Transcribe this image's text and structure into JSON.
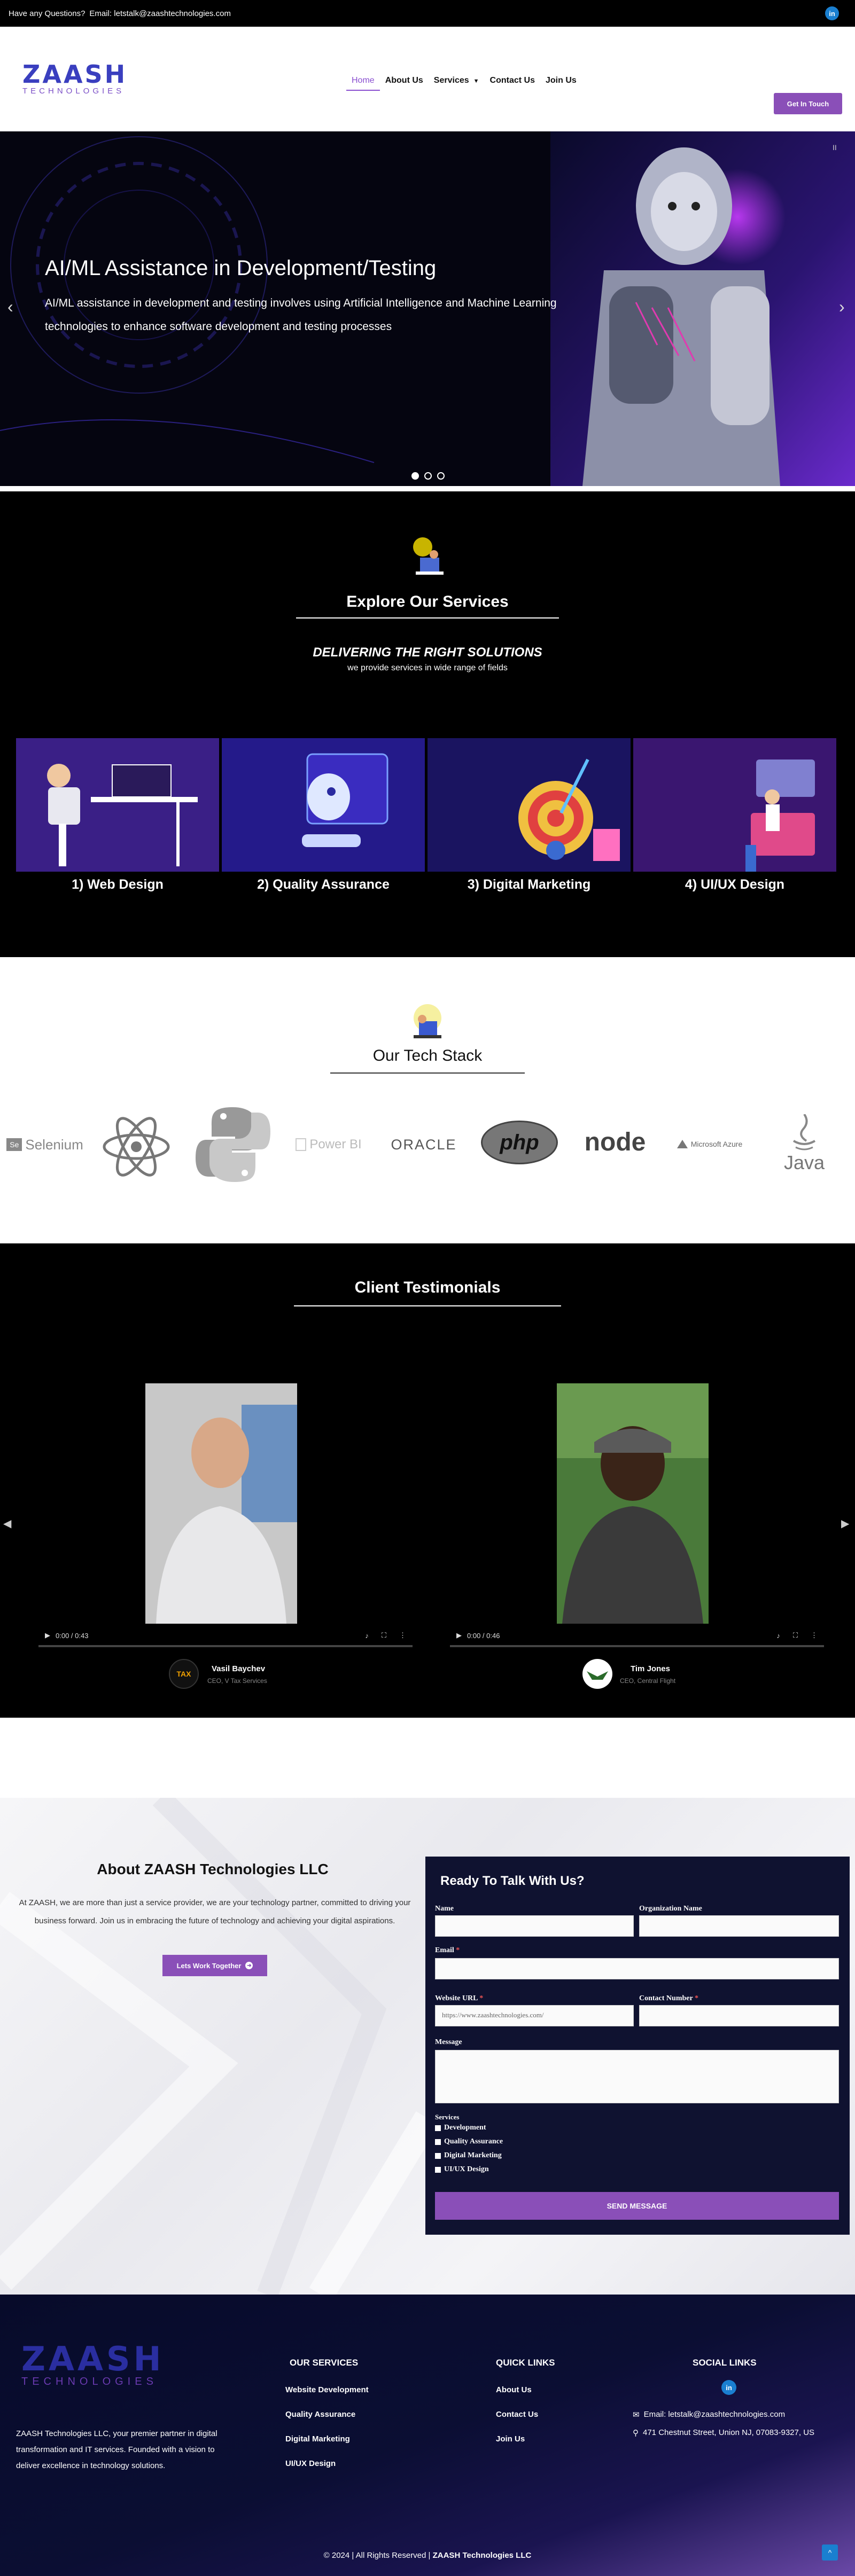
{
  "topbar": {
    "question": "Have any Questions?",
    "email_label": "Email: letstalk@zaashtechnologies.com",
    "linkedin": "in"
  },
  "header": {
    "logo_main": "ZAASH",
    "logo_sub": "TECHNOLOGIES",
    "nav": [
      "Home",
      "About Us",
      "Services",
      "Contact Us",
      "Join Us"
    ],
    "cta": "Get In Touch"
  },
  "hero": {
    "title": "AI/ML Assistance in Development/Testing",
    "description": "AI/ML assistance in development and testing involves using Artificial Intelligence and Machine Learning technologies to enhance software development and testing processes",
    "prev": "‹",
    "next": "›",
    "pause": "II",
    "slides": 3,
    "active_slide": 1
  },
  "services": {
    "title": "Explore Our Services",
    "subtitle": "DELIVERING THE RIGHT SOLUTIONS",
    "tagline": "we provide services in wide range of fields",
    "cards": [
      "1) Web Design",
      "2) Quality Assurance",
      "3) Digital Marketing",
      "4) UI/UX Design"
    ]
  },
  "tech": {
    "title": "Our Tech Stack",
    "logos": [
      "Selenium",
      "React",
      "Python",
      "Power BI",
      "ORACLE",
      "php",
      "node",
      "Microsoft Azure",
      "Java"
    ]
  },
  "testimonials": {
    "title": "Client Testimonials",
    "videos": [
      {
        "time": "0:00 / 0:43",
        "name": "Vasil Baychev",
        "role": "CEO, V Tax Services"
      },
      {
        "time": "0:00 / 0:46",
        "name": "Tim Jones",
        "role": "CEO, Central Flight"
      }
    ]
  },
  "about": {
    "title": "About ZAASH Technologies LLC",
    "text": "At ZAASH, we are more than just a service provider, we are your technology partner, committed to driving your business forward. Join us in embracing the future of technology and achieving your digital aspirations.",
    "button": "Lets Work Together"
  },
  "form": {
    "title": "Ready To Talk With Us?",
    "name_label": "Name",
    "org_label": "Organization Name",
    "email_label": "Email",
    "url_label": "Website URL",
    "url_placeholder": "https://www.zaashtechnologies.com/",
    "contact_label": "Contact Number",
    "message_label": "Message",
    "services_label": "Services",
    "options": [
      "Development",
      "Quality Assurance",
      "Digital Marketing",
      "UI/UX Design"
    ],
    "submit": "SEND MESSAGE",
    "required_mark": "*"
  },
  "footer": {
    "about_text": "ZAASH Technologies LLC, your premier partner in digital transformation and IT services. Founded with a vision to deliver excellence in technology solutions.",
    "services_title": "OUR SERVICES",
    "services_links": [
      "Website Development",
      "Quality Assurance",
      "Digital Marketing",
      "UI/UX Design"
    ],
    "quick_title": "QUICK LINKS",
    "quick_links": [
      "About Us",
      "Contact Us",
      "Join Us"
    ],
    "social_title": "SOCIAL LINKS",
    "email": "Email: letstalk@zaashtechnologies.com",
    "address": "471 Chestnut Street, Union NJ, 07083-9327, US",
    "copyright_prefix": "© 2024 | All Rights Reserved | ",
    "copyright_company": "ZAASH Technologies LLC",
    "to_top": "^"
  },
  "colors": {
    "accent": "#8a4fb8",
    "brand_blue": "#3a3fbf",
    "linkedin": "#1a7fd0",
    "form_bg": "#0f1230"
  }
}
